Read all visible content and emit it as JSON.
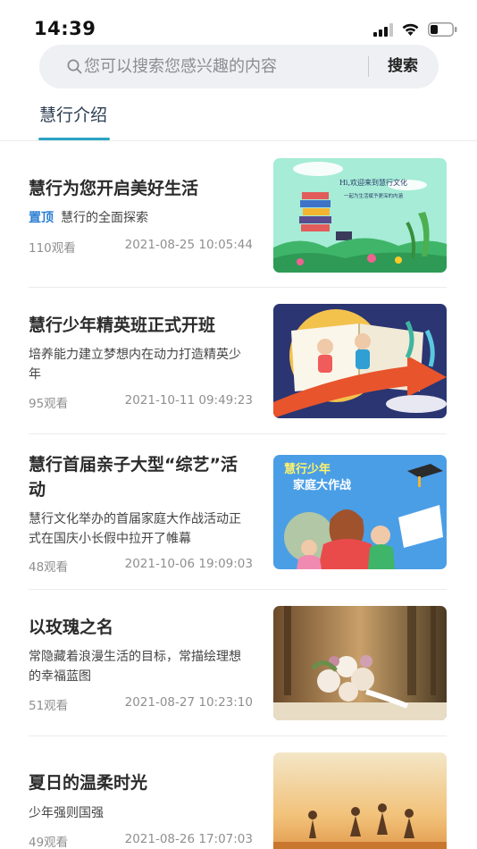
{
  "status_bar": {
    "time": "14:39"
  },
  "search": {
    "placeholder": "您可以搜索您感兴趣的内容",
    "button_label": "搜索"
  },
  "tabs": [
    {
      "label": "慧行介绍",
      "active": true
    }
  ],
  "accent_color": "#2aa3c4",
  "articles": [
    {
      "title": "慧行为您开启美好生活",
      "badge": "置顶",
      "desc": "慧行的全面探索",
      "views": "110观看",
      "date": "2021-08-25 10:05:44",
      "image_text": [
        "Hi,欢迎来到慧行文化",
        "一起为生活赋予更深的内涵"
      ]
    },
    {
      "title": "慧行少年精英班正式开班",
      "desc": "培养能力建立梦想内在动力打造精英少年",
      "views": "95观看",
      "date": "2021-10-11 09:49:23"
    },
    {
      "title": "慧行首届亲子大型“综艺”活动",
      "desc": "慧行文化举办的首届家庭大作战活动正式在国庆小长假中拉开了帷幕",
      "views": "48观看",
      "date": "2021-10-06 19:09:03",
      "image_text": [
        "慧行少年",
        "家庭大作战"
      ]
    },
    {
      "title": "以玫瑰之名",
      "desc": "常隐藏着浪漫生活的目标，常描绘理想的幸福蓝图",
      "views": "51观看",
      "date": "2021-08-27 10:23:10"
    },
    {
      "title": "夏日的温柔时光",
      "desc": "少年强则国强",
      "views": "49观看",
      "date": "2021-08-26 17:07:03"
    }
  ]
}
